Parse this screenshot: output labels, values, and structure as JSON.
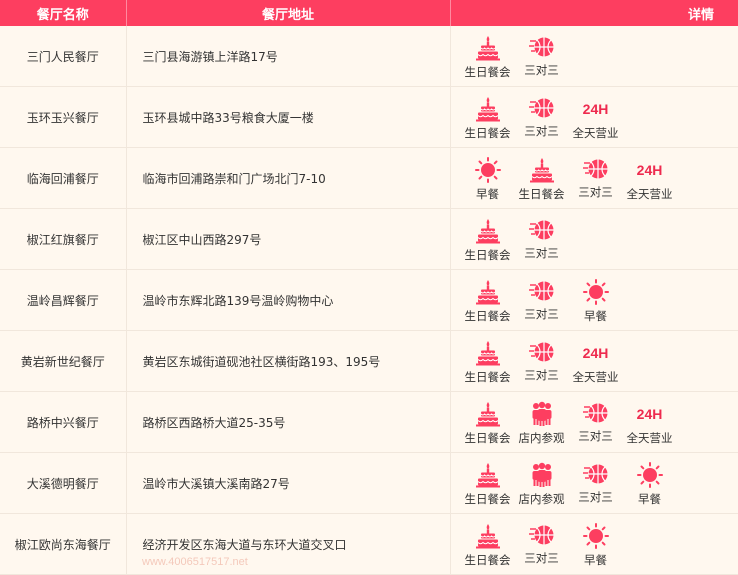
{
  "header": {
    "col_name": "餐厅名称",
    "col_address": "餐厅地址",
    "col_details": "详情"
  },
  "features": {
    "cake": "生日餐会",
    "ball": "三对三",
    "h24": "全天营业",
    "h24_badge": "24H",
    "sun": "早餐",
    "people": "店内参观"
  },
  "icons": {
    "cake": "birthday-cake-icon",
    "ball": "basketball-icon",
    "h24": "24-hour-icon",
    "sun": "sun-icon",
    "people": "visitors-icon"
  },
  "accent_color": "#fd3e60",
  "rows": [
    {
      "name": "三门人民餐厅",
      "address": "三门县海游镇上洋路17号",
      "features": [
        "cake",
        "ball"
      ]
    },
    {
      "name": "玉环玉兴餐厅",
      "address": "玉环县城中路33号粮食大厦一楼",
      "features": [
        "cake",
        "ball",
        "h24"
      ]
    },
    {
      "name": "临海回浦餐厅",
      "address": "临海市回浦路崇和门广场北门7-10",
      "features": [
        "sun",
        "cake",
        "ball",
        "h24"
      ]
    },
    {
      "name": "椒江红旗餐厅",
      "address": "椒江区中山西路297号",
      "features": [
        "cake",
        "ball"
      ]
    },
    {
      "name": "温岭昌辉餐厅",
      "address": "温岭市东辉北路139号温岭购物中心",
      "features": [
        "cake",
        "ball",
        "sun"
      ]
    },
    {
      "name": "黄岩新世纪餐厅",
      "address": "黄岩区东城街道砚池社区横街路193、195号",
      "features": [
        "cake",
        "ball",
        "h24"
      ]
    },
    {
      "name": "路桥中兴餐厅",
      "address": "路桥区西路桥大道25-35号",
      "features": [
        "cake",
        "people",
        "ball",
        "h24"
      ]
    },
    {
      "name": "大溪德明餐厅",
      "address": "温岭市大溪镇大溪南路27号",
      "features": [
        "cake",
        "people",
        "ball",
        "sun"
      ]
    },
    {
      "name": "椒江欧尚东海餐厅",
      "address": "经济开发区东海大道与东环大道交叉口",
      "features": [
        "cake",
        "ball",
        "sun"
      ]
    }
  ],
  "watermark": "www.4006517517.net"
}
